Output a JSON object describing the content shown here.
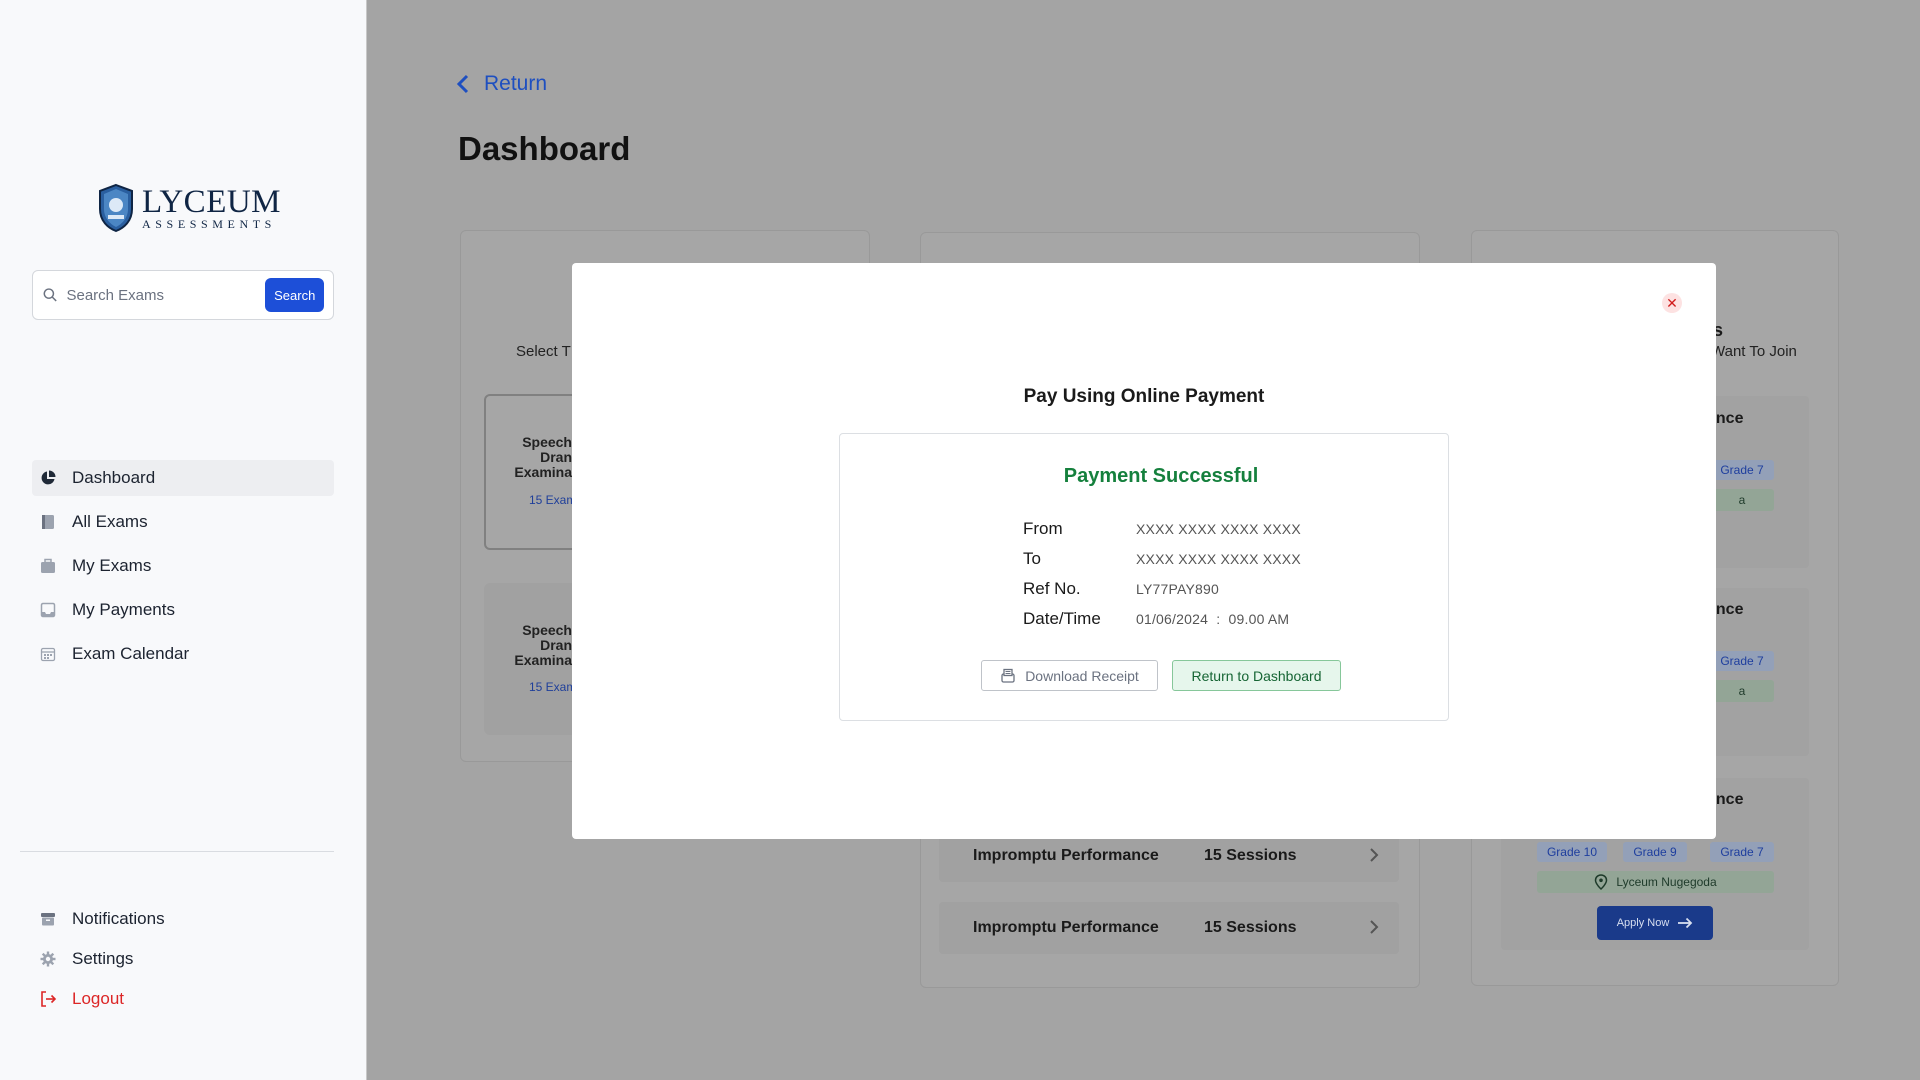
{
  "brand": {
    "name": "LYCEUM",
    "tagline": "ASSESSMENTS"
  },
  "search": {
    "placeholder": "Search Exams",
    "button_label": "Search"
  },
  "sidebar": {
    "items": [
      {
        "label": "Dashboard",
        "icon": "pie-chart-icon",
        "active": true
      },
      {
        "label": "All Exams",
        "icon": "book-icon"
      },
      {
        "label": "My Exams",
        "icon": "briefcase-icon"
      },
      {
        "label": "My Payments",
        "icon": "inbox-icon"
      },
      {
        "label": "Exam Calendar",
        "icon": "calendar-icon"
      }
    ],
    "bottom": [
      {
        "label": "Notifications",
        "icon": "archive-icon"
      },
      {
        "label": "Settings",
        "icon": "gear-icon"
      },
      {
        "label": "Logout",
        "icon": "logout-icon"
      }
    ]
  },
  "main": {
    "return_label": "Return",
    "title": "Dashboard",
    "card_a": {
      "subtitle_partial": "Select T",
      "items": [
        {
          "title_lines": [
            "Speech",
            "Dran",
            "Examina"
          ],
          "sub": "15 Exam"
        },
        {
          "title_lines": [
            "Speech",
            "Dran",
            "Examina"
          ],
          "sub": "15 Exam"
        }
      ]
    },
    "card_b": {
      "rows": [
        {
          "name": "Impromptu Performance",
          "sessions": "15 Sessions"
        },
        {
          "name": "Impromptu Performance",
          "sessions": "15 Sessions"
        }
      ]
    },
    "card_c": {
      "header_partial": "s",
      "subtitle_partial": "Want To Join",
      "box_title_partial": "ance",
      "chips": [
        "Grade 10",
        "Grade 9",
        "Grade 7"
      ],
      "chip_partial": "Grade 7",
      "location_partial": "a",
      "location": "Lyceum Nugegoda",
      "apply_label": "Apply Now"
    }
  },
  "modal": {
    "title": "Pay Using Online Payment",
    "close_symbol": "✕",
    "status": "Payment Successful",
    "details": [
      {
        "label": "From",
        "value": "XXXX XXXX XXXX XXXX"
      },
      {
        "label": "To",
        "value": "XXXX XXXX XXXX XXXX"
      },
      {
        "label": "Ref No.",
        "value": "LY77PAY890"
      },
      {
        "label": "Date/Time",
        "value": "01/06/2024  :  09.00 AM"
      }
    ],
    "download_label": "Download Receipt",
    "return_label": "Return to Dashboard"
  },
  "colors": {
    "accent": "#1d4fd8",
    "success": "#15803d",
    "danger": "#dc2626",
    "overlay": "#a4a4a4"
  }
}
